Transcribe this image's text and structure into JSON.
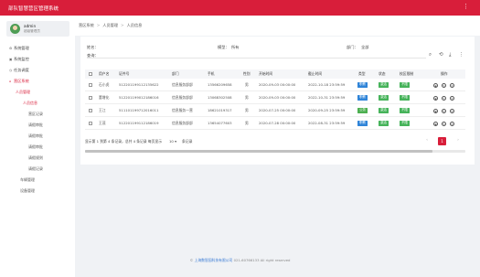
{
  "app": {
    "title": "部队智慧营区管理系统",
    "menu_icon": "menu-icon"
  },
  "user": {
    "name": "admin",
    "role": "超级管理员"
  },
  "nav": [
    {
      "label": "系统管理",
      "icon": "gear-icon"
    },
    {
      "label": "系统监控",
      "icon": "monitor-icon"
    },
    {
      "label": "任务调度",
      "icon": "schedule-icon"
    },
    {
      "label": "营区系统",
      "icon": "home-icon"
    }
  ],
  "subnav": {
    "group": "人员管理",
    "items": [
      "人员信息",
      "营区记录",
      "请假审批",
      "请假审批",
      "请假审批",
      "请假规则",
      "请假记录"
    ]
  },
  "nav_extra": [
    "车辆管理",
    "设备管理"
  ],
  "breadcrumb": {
    "root": "营区系统",
    "mid": "人员管理",
    "current": "人员信息"
  },
  "filters": {
    "name_label": "姓名：",
    "name_value": "",
    "mode_label": "模型：",
    "mode_value": "所有",
    "dept_label": "部门：",
    "dept_value": "全部",
    "query_label": "查询：",
    "query_value": ""
  },
  "table": {
    "headers": [
      "用户名",
      "证件号",
      "部门",
      "手机",
      "性别",
      "开始时间",
      "截止时间",
      "类型",
      "状态",
      "校区限制",
      "操作"
    ],
    "rows": [
      {
        "name": "石小虎",
        "id": "512201199112135622",
        "dept": "信息服务部部",
        "phone": "13566209658",
        "gender": "男",
        "start": "2020-09-03 00:00:00",
        "end": "2022-10-18 23:59:59",
        "type": "职教",
        "status": "激活",
        "limit": "不限"
      },
      {
        "name": "董增化",
        "id": "512201199012186016",
        "dept": "信息服务部部",
        "phone": "13068302508",
        "gender": "男",
        "start": "2020-09-03 00:00:00",
        "end": "2022-10-31 23:59:59",
        "type": "职教",
        "status": "激活",
        "limit": "不限"
      },
      {
        "name": "王江",
        "id": "511101199712016011",
        "dept": "信息服务一营",
        "phone": "18621019317",
        "gender": "男",
        "start": "2020-07-25 00:00:00",
        "end": "2020-09-25 23:59:59",
        "type": "公务",
        "status": "激活",
        "limit": "不限"
      },
      {
        "name": "王茂",
        "id": "512201199112186019",
        "dept": "信息服务部部",
        "phone": "13654077603",
        "gender": "男",
        "start": "2020-07-28 00:00:00",
        "end": "2022-08-31 23:59:59",
        "type": "职教",
        "status": "激活",
        "limit": "不限"
      }
    ]
  },
  "pagination": {
    "info": "显示第 1 到第 4 条记录，总共 4 条记录 每页显示",
    "page_size": "10",
    "info2": "条记录",
    "prev": "‹",
    "current": "1",
    "next": "›"
  },
  "footer": {
    "company": "上海数智园科技有限公司",
    "copy": "021-60766133 All right reserved"
  },
  "colors": {
    "brand": "#d81e3a",
    "type_blue": "#2f84d8",
    "type_green": "#4caf50",
    "active_green": "#46b35a"
  }
}
